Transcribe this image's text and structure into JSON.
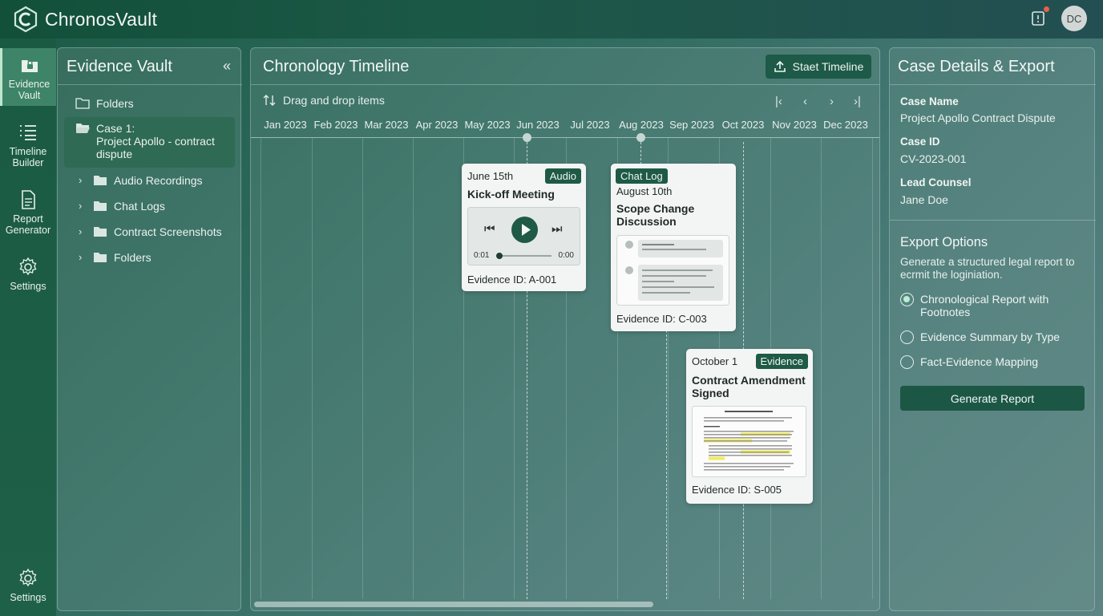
{
  "app": {
    "name": "ChronosVault",
    "avatar_initials": "DC"
  },
  "rail": {
    "items": [
      {
        "label": "Evidence\nVault",
        "icon": "lock-folder-icon"
      },
      {
        "label": "Timeline\nBuilder",
        "icon": "list-icon"
      },
      {
        "label": "Report\nGenerator",
        "icon": "document-icon"
      },
      {
        "label": "Settings",
        "icon": "gear-icon"
      }
    ],
    "bottom_label": "Settings"
  },
  "vault": {
    "title": "Evidence Vault",
    "root_folder": "Folders",
    "case_label": "Case 1:\nProject Apollo - contract\ndispute",
    "children": [
      "Audio Recordings",
      "Chat Logs",
      "Contract Screenshots",
      "Folders"
    ]
  },
  "timeline": {
    "title": "Chronology Timeline",
    "start_button": "Staet Timeline",
    "hint": "Drag and drop items",
    "months": [
      "Jan 2023",
      "Feb 2023",
      "Mar 2023",
      "Apr 2023",
      "May 2023",
      "Jun 2023",
      "Jul 2023",
      "Aug 2023",
      "Sep 2023",
      "Oct 2023",
      "Nov 2023",
      "Dec 2023"
    ],
    "cards": {
      "audio": {
        "date": "June 15th",
        "tag": "Audio",
        "title": "Kick-off Meeting",
        "time_start": "0:01",
        "time_end": "0:00",
        "evidence_id": "Evidence ID: A-001",
        "progress": 0.05
      },
      "chat": {
        "tag": "Chat Log",
        "date": "August 10th",
        "title": "Scope Change\nDiscussion",
        "evidence_id": "Evidence ID: C-003"
      },
      "amendment": {
        "date": "October 1",
        "tag": "Evidence",
        "title": "Contract Amendment\nSigned",
        "evidence_id": "Evidence ID: S-005"
      }
    }
  },
  "details": {
    "title": "Case Details & Export",
    "case_name_label": "Case Name",
    "case_name": "Project Apollo Contract Dispute",
    "case_id_label": "Case ID",
    "case_id": "CV-2023-001",
    "lead_label": "Lead Counsel",
    "lead": "Jane Doe",
    "export_title": "Export Options",
    "export_desc": "Generate a structured legal report to\necrmit the loginiation.",
    "options": [
      "Chronological Report with\nFootnotes",
      "Evidence Summary by Type",
      "Fact-Evidence Mapping"
    ],
    "selected_option": 0,
    "generate_button": "Generate Report"
  },
  "colors": {
    "accent": "#1e5a46",
    "rail": "#1a5a43",
    "active": "#3e8468"
  }
}
